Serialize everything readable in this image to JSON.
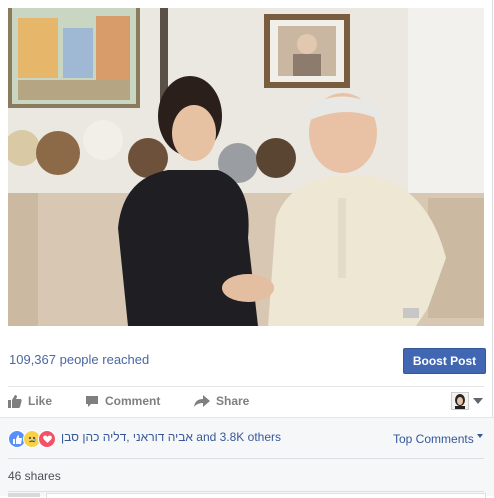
{
  "post": {
    "photo_alt": "photo",
    "reach_text": "109,367 people reached",
    "boost_label": "Boost Post"
  },
  "actions": {
    "like": "Like",
    "comment": "Comment",
    "share": "Share"
  },
  "feedback": {
    "reaction_icons": [
      "like-icon",
      "sad-icon",
      "love-icon"
    ],
    "names_text": "אביה דוראני ,דליה כהן סבן",
    "names_suffix": " and 3.8K others",
    "top_comments": "Top Comments",
    "shares_text": "46 shares"
  },
  "colors": {
    "link": "#365899",
    "boost": "#4267b2",
    "muted": "#7f7f7f"
  }
}
